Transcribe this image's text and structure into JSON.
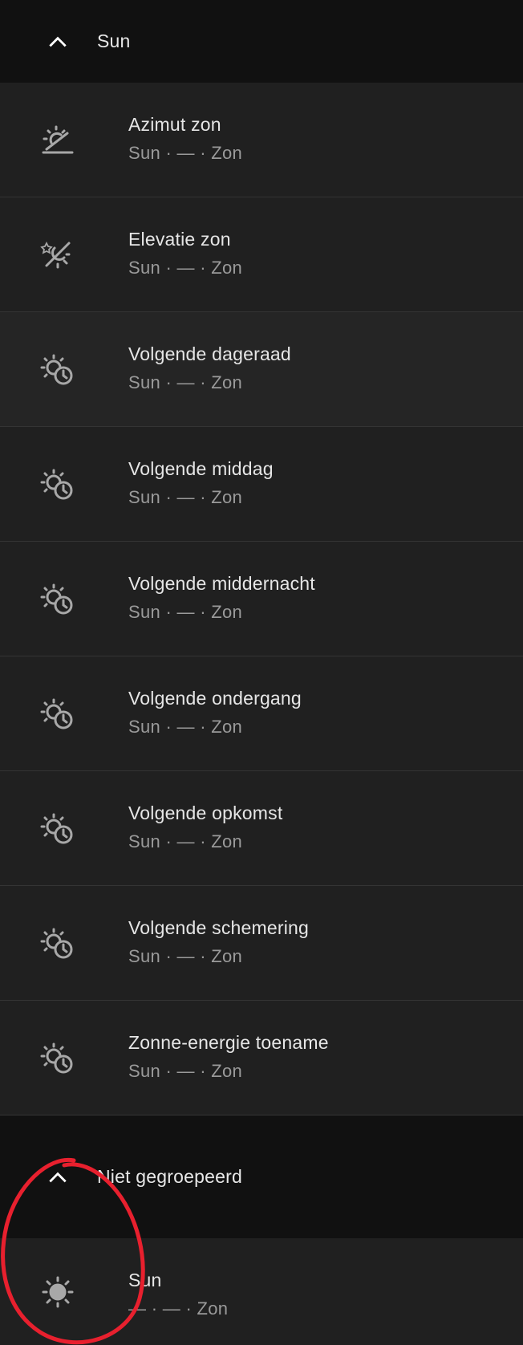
{
  "groups": [
    {
      "title": "Sun",
      "rows": [
        {
          "label": "Azimut zon",
          "sub": "Sun · — · Zon",
          "icon": "sun-azimuth-icon"
        },
        {
          "label": "Elevatie zon",
          "sub": "Sun · — · Zon",
          "icon": "sun-angle-icon"
        },
        {
          "label": "Volgende dageraad",
          "sub": "Sun · — · Zon",
          "icon": "sun-clock-icon"
        },
        {
          "label": "Volgende middag",
          "sub": "Sun · — · Zon",
          "icon": "sun-clock-icon"
        },
        {
          "label": "Volgende middernacht",
          "sub": "Sun · — · Zon",
          "icon": "sun-clock-icon"
        },
        {
          "label": "Volgende ondergang",
          "sub": "Sun · — · Zon",
          "icon": "sun-clock-icon"
        },
        {
          "label": "Volgende opkomst",
          "sub": "Sun · — · Zon",
          "icon": "sun-clock-icon"
        },
        {
          "label": "Volgende schemering",
          "sub": "Sun · — · Zon",
          "icon": "sun-clock-icon"
        },
        {
          "label": "Zonne-energie toename",
          "sub": "Sun · — · Zon",
          "icon": "sun-clock-icon"
        }
      ]
    },
    {
      "title": "Niet gegroepeerd",
      "rows": [
        {
          "label": "Sun",
          "sub": "— · — · Zon",
          "icon": "sun-icon"
        }
      ]
    }
  ],
  "colors": {
    "background": "#111111",
    "row": "#202020",
    "text_primary": "#e6e6e6",
    "text_secondary": "#9a9a9a",
    "icon": "#a8a8a8",
    "annotation": "#e8202e"
  }
}
